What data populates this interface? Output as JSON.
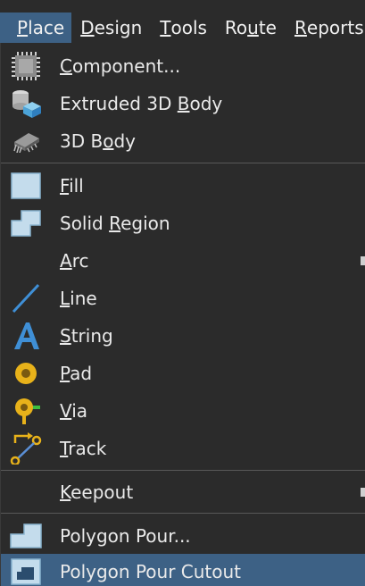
{
  "menubar": {
    "items": [
      {
        "pre": "",
        "ul": "P",
        "post": "lace"
      },
      {
        "pre": "",
        "ul": "D",
        "post": "esign"
      },
      {
        "pre": "",
        "ul": "T",
        "post": "ools"
      },
      {
        "pre": "Ro",
        "ul": "u",
        "post": "te"
      },
      {
        "pre": "",
        "ul": "R",
        "post": "eports"
      }
    ]
  },
  "menu": {
    "items": [
      {
        "pre": "",
        "ul": "C",
        "post": "omponent...",
        "icon": "component-icon"
      },
      {
        "pre": "Extruded 3D ",
        "ul": "B",
        "post": "ody",
        "icon": "extruded-3d-body-icon"
      },
      {
        "pre": "3D B",
        "ul": "o",
        "post": "dy",
        "icon": "3d-body-icon"
      },
      {
        "pre": "",
        "ul": "F",
        "post": "ill",
        "icon": "fill-icon"
      },
      {
        "pre": "Solid ",
        "ul": "R",
        "post": "egion",
        "icon": "solid-region-icon"
      },
      {
        "pre": "",
        "ul": "A",
        "post": "rc",
        "icon": ""
      },
      {
        "pre": "",
        "ul": "L",
        "post": "ine",
        "icon": "line-icon"
      },
      {
        "pre": "",
        "ul": "S",
        "post": "tring",
        "icon": "string-icon"
      },
      {
        "pre": "",
        "ul": "P",
        "post": "ad",
        "icon": "pad-icon"
      },
      {
        "pre": "",
        "ul": "V",
        "post": "ia",
        "icon": "via-icon"
      },
      {
        "pre": "",
        "ul": "T",
        "post": "rack",
        "icon": "track-icon"
      },
      {
        "pre": "",
        "ul": "K",
        "post": "eepout",
        "icon": ""
      },
      {
        "pre": "Polygon Pour...",
        "ul": "",
        "post": "",
        "icon": "polygon-pour-icon"
      },
      {
        "pre": "Polygon Pour Cutout",
        "ul": "",
        "post": "",
        "icon": "polygon-pour-cutout-icon"
      }
    ]
  },
  "colors": {
    "background": "#2b2b2b",
    "highlight": "#3d6185",
    "text": "#eaeaea",
    "separator": "#585858"
  }
}
